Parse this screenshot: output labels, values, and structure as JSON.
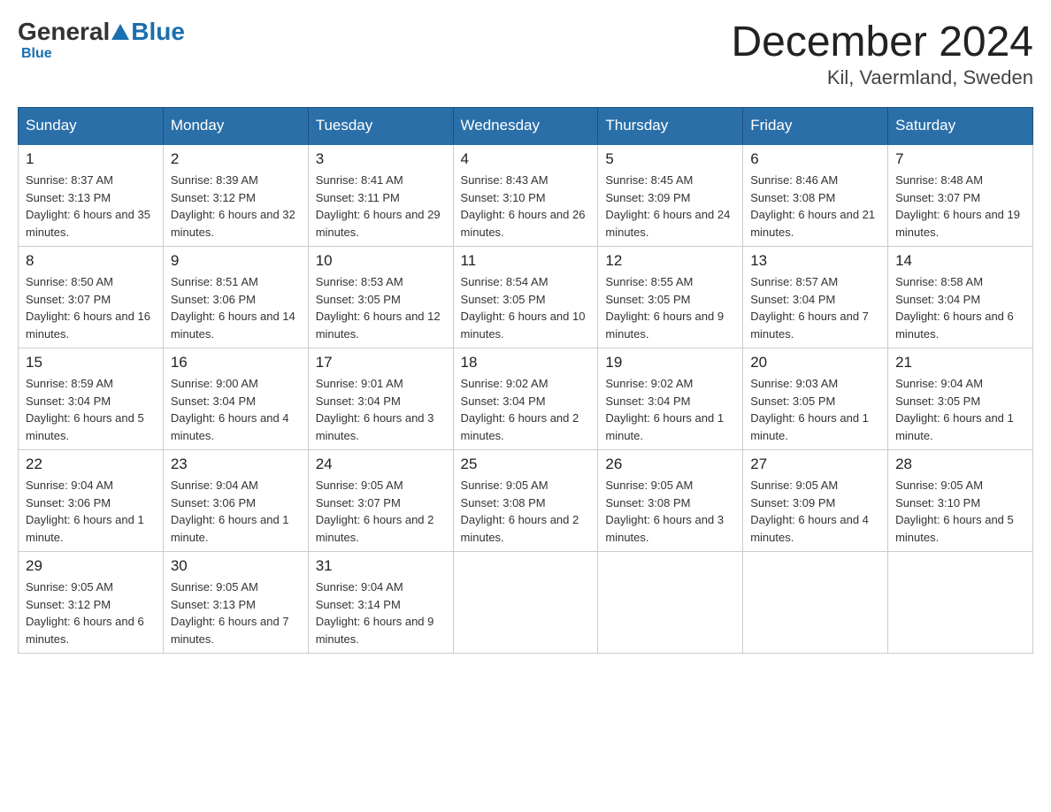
{
  "header": {
    "logo_general": "General",
    "logo_blue": "Blue",
    "calendar_title": "December 2024",
    "calendar_subtitle": "Kil, Vaermland, Sweden"
  },
  "days_of_week": [
    "Sunday",
    "Monday",
    "Tuesday",
    "Wednesday",
    "Thursday",
    "Friday",
    "Saturday"
  ],
  "weeks": [
    [
      {
        "day": "1",
        "sunrise": "8:37 AM",
        "sunset": "3:13 PM",
        "daylight": "6 hours and 35 minutes."
      },
      {
        "day": "2",
        "sunrise": "8:39 AM",
        "sunset": "3:12 PM",
        "daylight": "6 hours and 32 minutes."
      },
      {
        "day": "3",
        "sunrise": "8:41 AM",
        "sunset": "3:11 PM",
        "daylight": "6 hours and 29 minutes."
      },
      {
        "day": "4",
        "sunrise": "8:43 AM",
        "sunset": "3:10 PM",
        "daylight": "6 hours and 26 minutes."
      },
      {
        "day": "5",
        "sunrise": "8:45 AM",
        "sunset": "3:09 PM",
        "daylight": "6 hours and 24 minutes."
      },
      {
        "day": "6",
        "sunrise": "8:46 AM",
        "sunset": "3:08 PM",
        "daylight": "6 hours and 21 minutes."
      },
      {
        "day": "7",
        "sunrise": "8:48 AM",
        "sunset": "3:07 PM",
        "daylight": "6 hours and 19 minutes."
      }
    ],
    [
      {
        "day": "8",
        "sunrise": "8:50 AM",
        "sunset": "3:07 PM",
        "daylight": "6 hours and 16 minutes."
      },
      {
        "day": "9",
        "sunrise": "8:51 AM",
        "sunset": "3:06 PM",
        "daylight": "6 hours and 14 minutes."
      },
      {
        "day": "10",
        "sunrise": "8:53 AM",
        "sunset": "3:05 PM",
        "daylight": "6 hours and 12 minutes."
      },
      {
        "day": "11",
        "sunrise": "8:54 AM",
        "sunset": "3:05 PM",
        "daylight": "6 hours and 10 minutes."
      },
      {
        "day": "12",
        "sunrise": "8:55 AM",
        "sunset": "3:05 PM",
        "daylight": "6 hours and 9 minutes."
      },
      {
        "day": "13",
        "sunrise": "8:57 AM",
        "sunset": "3:04 PM",
        "daylight": "6 hours and 7 minutes."
      },
      {
        "day": "14",
        "sunrise": "8:58 AM",
        "sunset": "3:04 PM",
        "daylight": "6 hours and 6 minutes."
      }
    ],
    [
      {
        "day": "15",
        "sunrise": "8:59 AM",
        "sunset": "3:04 PM",
        "daylight": "6 hours and 5 minutes."
      },
      {
        "day": "16",
        "sunrise": "9:00 AM",
        "sunset": "3:04 PM",
        "daylight": "6 hours and 4 minutes."
      },
      {
        "day": "17",
        "sunrise": "9:01 AM",
        "sunset": "3:04 PM",
        "daylight": "6 hours and 3 minutes."
      },
      {
        "day": "18",
        "sunrise": "9:02 AM",
        "sunset": "3:04 PM",
        "daylight": "6 hours and 2 minutes."
      },
      {
        "day": "19",
        "sunrise": "9:02 AM",
        "sunset": "3:04 PM",
        "daylight": "6 hours and 1 minute."
      },
      {
        "day": "20",
        "sunrise": "9:03 AM",
        "sunset": "3:05 PM",
        "daylight": "6 hours and 1 minute."
      },
      {
        "day": "21",
        "sunrise": "9:04 AM",
        "sunset": "3:05 PM",
        "daylight": "6 hours and 1 minute."
      }
    ],
    [
      {
        "day": "22",
        "sunrise": "9:04 AM",
        "sunset": "3:06 PM",
        "daylight": "6 hours and 1 minute."
      },
      {
        "day": "23",
        "sunrise": "9:04 AM",
        "sunset": "3:06 PM",
        "daylight": "6 hours and 1 minute."
      },
      {
        "day": "24",
        "sunrise": "9:05 AM",
        "sunset": "3:07 PM",
        "daylight": "6 hours and 2 minutes."
      },
      {
        "day": "25",
        "sunrise": "9:05 AM",
        "sunset": "3:08 PM",
        "daylight": "6 hours and 2 minutes."
      },
      {
        "day": "26",
        "sunrise": "9:05 AM",
        "sunset": "3:08 PM",
        "daylight": "6 hours and 3 minutes."
      },
      {
        "day": "27",
        "sunrise": "9:05 AM",
        "sunset": "3:09 PM",
        "daylight": "6 hours and 4 minutes."
      },
      {
        "day": "28",
        "sunrise": "9:05 AM",
        "sunset": "3:10 PM",
        "daylight": "6 hours and 5 minutes."
      }
    ],
    [
      {
        "day": "29",
        "sunrise": "9:05 AM",
        "sunset": "3:12 PM",
        "daylight": "6 hours and 6 minutes."
      },
      {
        "day": "30",
        "sunrise": "9:05 AM",
        "sunset": "3:13 PM",
        "daylight": "6 hours and 7 minutes."
      },
      {
        "day": "31",
        "sunrise": "9:04 AM",
        "sunset": "3:14 PM",
        "daylight": "6 hours and 9 minutes."
      },
      null,
      null,
      null,
      null
    ]
  ]
}
